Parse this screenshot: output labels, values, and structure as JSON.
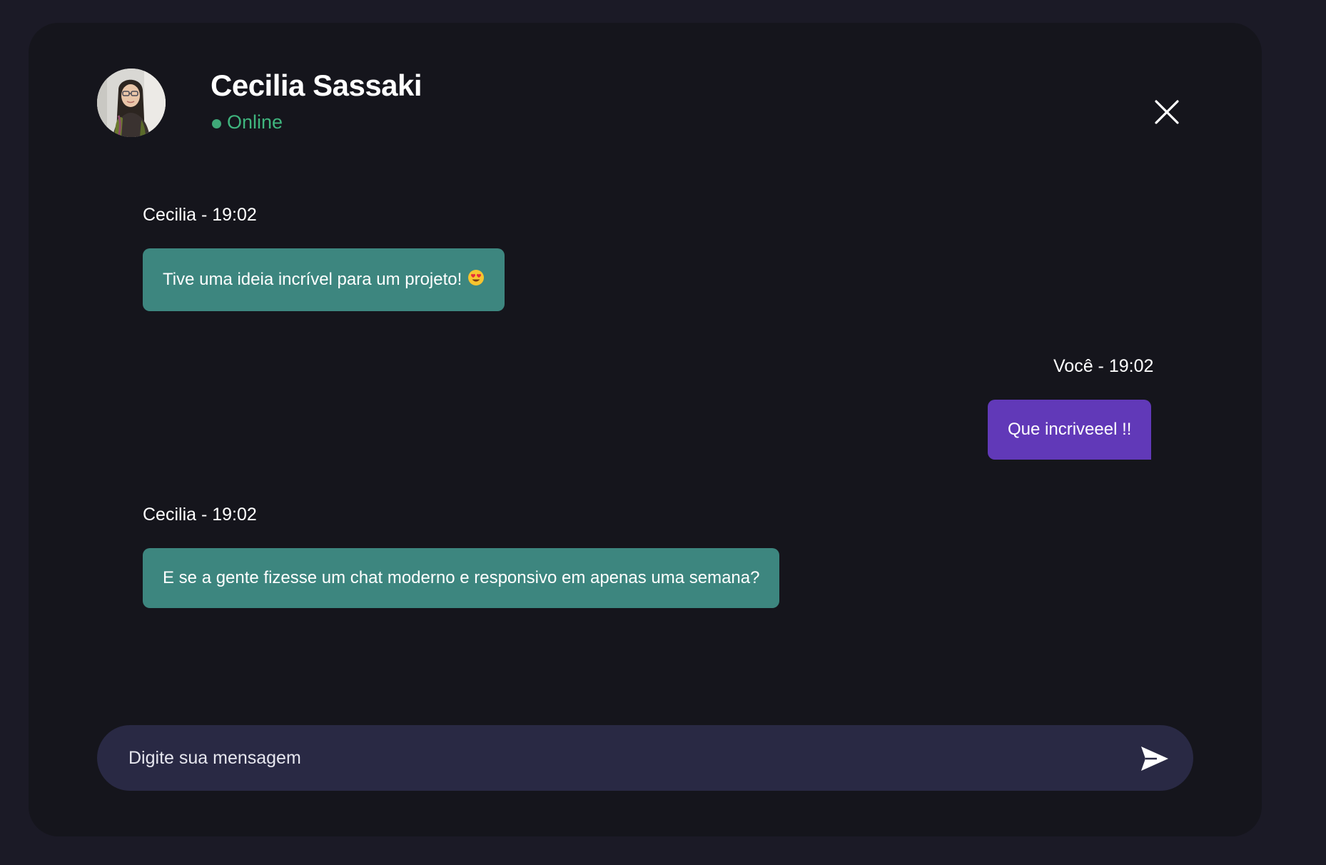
{
  "header": {
    "contact_name": "Cecilia Sassaki",
    "status_text": "Online",
    "avatar_alt": "Cecilia Sassaki",
    "close_icon": "close-icon"
  },
  "messages": [
    {
      "meta": "Cecilia - 19:02",
      "text": "Tive uma ideia incrível para um projeto!",
      "emoji": "heart-eyes-emoji",
      "direction": "incoming"
    },
    {
      "meta": "Você - 19:02",
      "text": "Que incriveeel !!",
      "direction": "outgoing"
    },
    {
      "meta": "Cecilia - 19:02",
      "text": "E se a gente fizesse um chat moderno e responsivo em apenas uma semana?",
      "direction": "incoming"
    }
  ],
  "composer": {
    "placeholder": "Digite sua mensagem",
    "value": "",
    "send_icon": "send-icon"
  },
  "colors": {
    "page_background": "#1b1a26",
    "window_background": "#15151c",
    "incoming_bubble": "#3d867f",
    "outgoing_bubble": "#6139b8",
    "status_online": "#3fb57e",
    "composer_background": "#292944"
  }
}
